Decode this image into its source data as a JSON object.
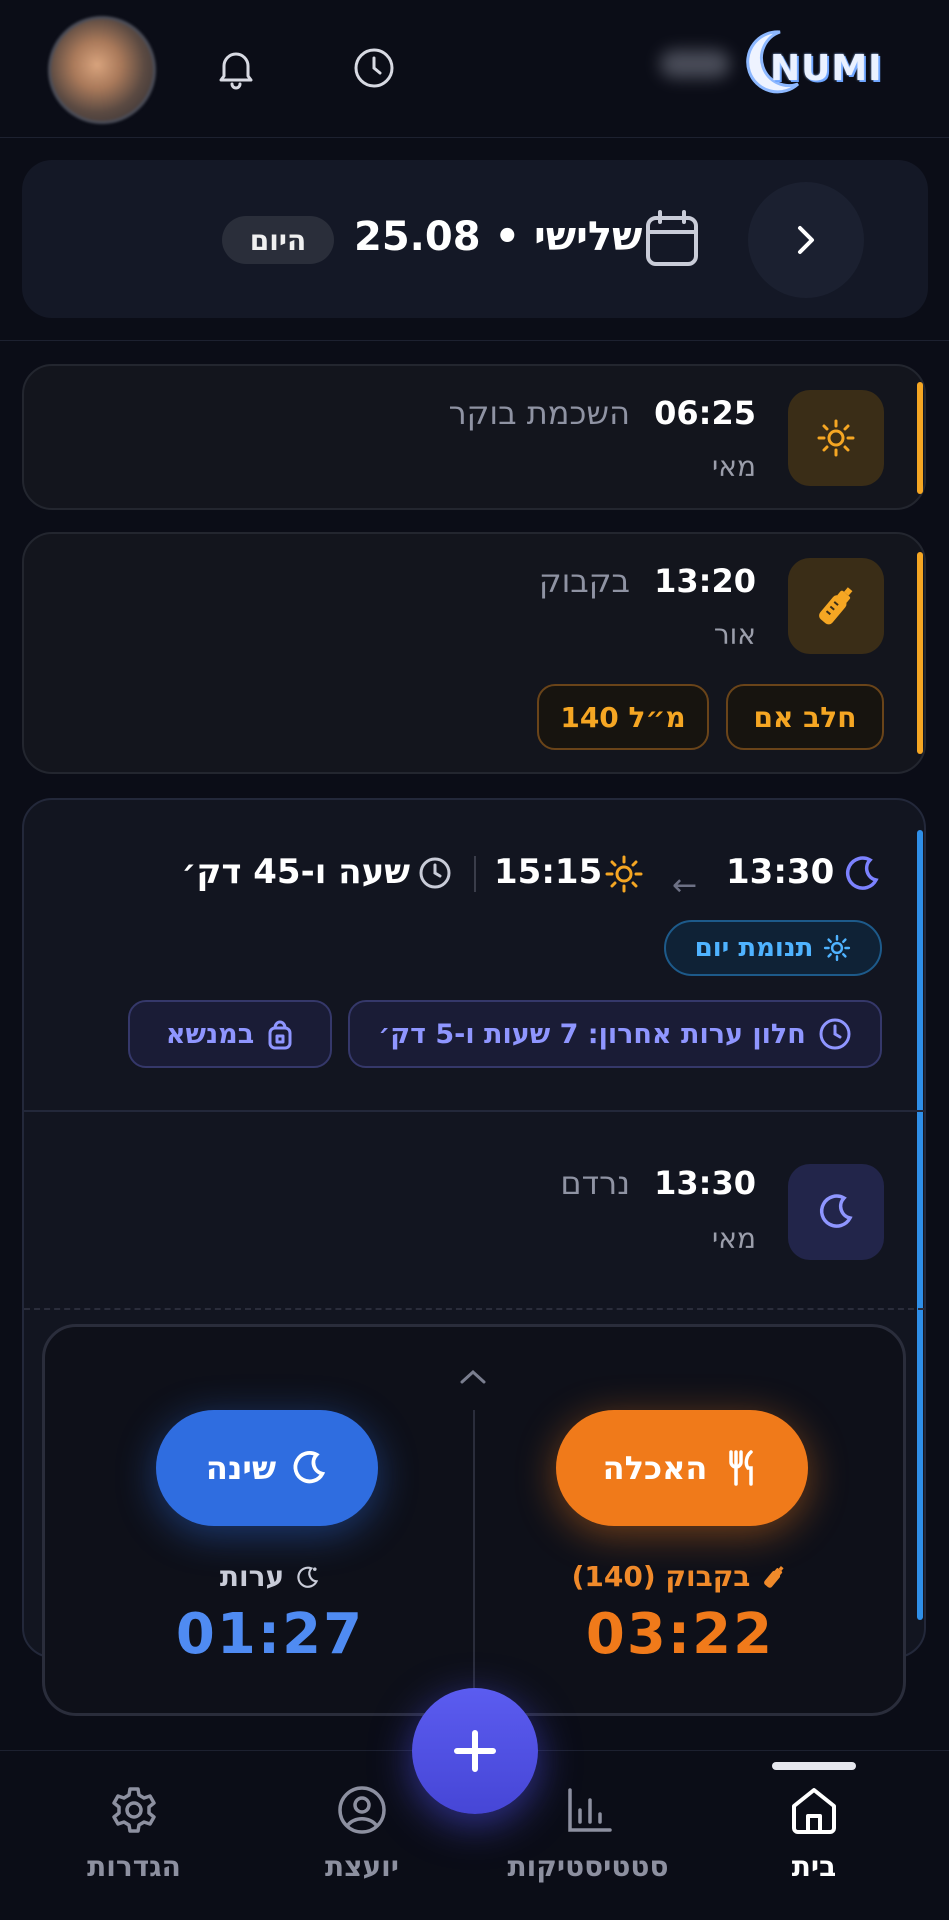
{
  "app": {
    "logo_text": "NUMI"
  },
  "date_bar": {
    "date": "25.08 • שלישי",
    "today": "היום"
  },
  "events": [
    {
      "time": "06:25",
      "title": "השכמת בוקר",
      "by": "מאי",
      "icon": "sun-icon"
    },
    {
      "time": "13:20",
      "title": "בקבוק",
      "by": "אור",
      "icon": "bottle-icon",
      "tags": [
        "חלב אם",
        "140 מ״ל"
      ]
    }
  ],
  "sleep_session": {
    "start": "13:30",
    "end": "15:15",
    "duration": "שעה ו-45 דק׳",
    "type": "תנומת יום",
    "wake_window": "חלון ערות אחרון: 7 שעות ו-5 דק׳",
    "location": "במנשא"
  },
  "sleep_event": {
    "time": "13:30",
    "title": "נרדם",
    "by": "מאי",
    "icon": "moon-icon"
  },
  "quick_panel": {
    "sleep_button": "שינה",
    "feed_button": "האכלה",
    "awake_label": "ערות",
    "awake_timer": "01:27",
    "feed_label": "בקבוק (140)",
    "feed_timer": "03:22"
  },
  "nav": {
    "home": "בית",
    "stats": "סטטיסטיקות",
    "advisor": "יועצת",
    "settings": "הגדרות"
  },
  "colors": {
    "accent_orange": "#f5a623",
    "accent_blue": "#2f8fe8",
    "primary_violet": "#5b5cf0",
    "sleep_blue": "#2f6de0",
    "feed_orange": "#f07a1a"
  }
}
